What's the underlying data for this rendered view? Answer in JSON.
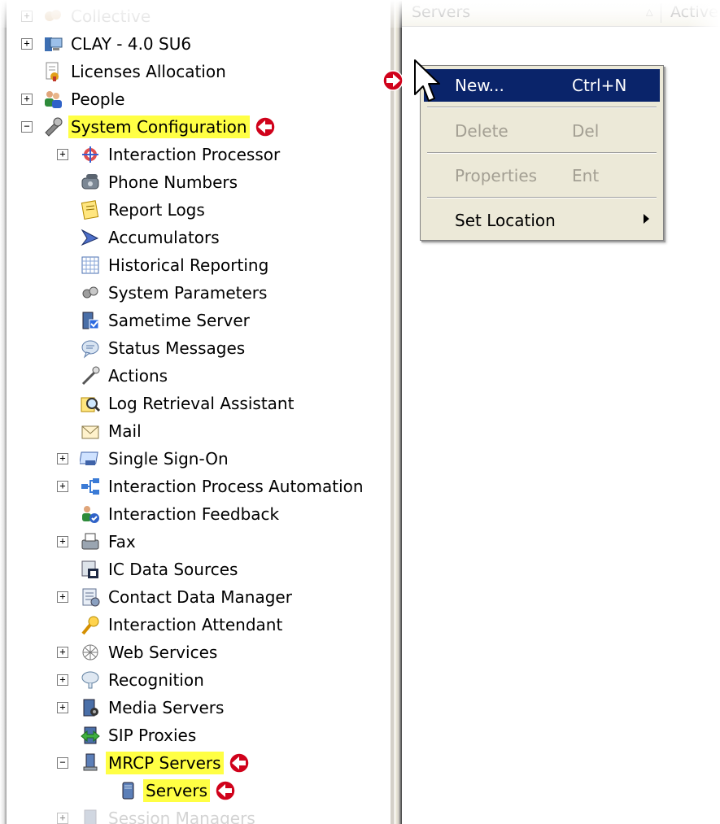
{
  "list_header": {
    "columns": [
      "Servers",
      "Active"
    ]
  },
  "tree": [
    {
      "id": "collective",
      "label": "Collective",
      "expander": "+",
      "icon": "collective-icon",
      "dim": true
    },
    {
      "id": "clay",
      "label": "CLAY - 4.0 SU6",
      "expander": "+",
      "icon": "server-computer-icon"
    },
    {
      "id": "licenses",
      "label": "Licenses Allocation",
      "expander": null,
      "icon": "license-icon"
    },
    {
      "id": "people",
      "label": "People",
      "expander": "+",
      "icon": "people-icon"
    },
    {
      "id": "sysconfig",
      "label": "System Configuration",
      "expander": "−",
      "icon": "wrench-icon",
      "highlight": true,
      "arrow": true
    },
    {
      "id": "ip",
      "label": "Interaction Processor",
      "expander": "+",
      "icon": "processor-icon"
    },
    {
      "id": "phone",
      "label": "Phone Numbers",
      "expander": null,
      "icon": "phone-icon"
    },
    {
      "id": "reportlogs",
      "label": "Report Logs",
      "expander": null,
      "icon": "notepad-icon"
    },
    {
      "id": "accum",
      "label": "Accumulators",
      "expander": null,
      "icon": "accumulator-icon"
    },
    {
      "id": "histrep",
      "label": "Historical Reporting",
      "expander": null,
      "icon": "grid-icon"
    },
    {
      "id": "sysparams",
      "label": "System Parameters",
      "expander": null,
      "icon": "gears-icon"
    },
    {
      "id": "sametime",
      "label": "Sametime Server",
      "expander": null,
      "icon": "sametime-server-icon"
    },
    {
      "id": "status",
      "label": "Status Messages",
      "expander": null,
      "icon": "speech-bubble-icon"
    },
    {
      "id": "actions",
      "label": "Actions",
      "expander": null,
      "icon": "wand-icon"
    },
    {
      "id": "logret",
      "label": "Log Retrieval Assistant",
      "expander": null,
      "icon": "magnifier-icon"
    },
    {
      "id": "mail",
      "label": "Mail",
      "expander": null,
      "icon": "envelope-icon"
    },
    {
      "id": "sso",
      "label": "Single Sign-On",
      "expander": "+",
      "icon": "sso-icon"
    },
    {
      "id": "ipa",
      "label": "Interaction Process Automation",
      "expander": "+",
      "icon": "flowchart-icon"
    },
    {
      "id": "feedback",
      "label": "Interaction Feedback",
      "expander": null,
      "icon": "feedback-icon"
    },
    {
      "id": "fax",
      "label": "Fax",
      "expander": "+",
      "icon": "fax-icon"
    },
    {
      "id": "icdata",
      "label": "IC Data Sources",
      "expander": null,
      "icon": "data-source-icon"
    },
    {
      "id": "cdm",
      "label": "Contact Data Manager",
      "expander": "+",
      "icon": "contact-data-icon"
    },
    {
      "id": "attendant",
      "label": "Interaction Attendant",
      "expander": null,
      "icon": "attendant-icon"
    },
    {
      "id": "websvc",
      "label": "Web Services",
      "expander": "+",
      "icon": "web-icon"
    },
    {
      "id": "recog",
      "label": "Recognition",
      "expander": "+",
      "icon": "recognition-icon"
    },
    {
      "id": "media",
      "label": "Media Servers",
      "expander": "+",
      "icon": "media-server-icon"
    },
    {
      "id": "sip",
      "label": "SIP Proxies",
      "expander": null,
      "icon": "sip-proxy-icon"
    },
    {
      "id": "mrcp",
      "label": "MRCP Servers",
      "expander": "−",
      "icon": "mrcp-server-icon",
      "highlight": true,
      "arrow": true
    },
    {
      "id": "servers",
      "label": "Servers",
      "expander": null,
      "icon": "server-icon",
      "highlight": true,
      "arrow": true
    },
    {
      "id": "sessmgr",
      "label": "Session Managers",
      "expander": "+",
      "icon": "session-manager-icon",
      "dim": true
    }
  ],
  "context_menu": {
    "items": [
      {
        "label": "New...",
        "shortcut": "Ctrl+N",
        "state": "selected"
      },
      {
        "label": "Delete",
        "shortcut": "Del",
        "state": "disabled"
      },
      {
        "label": "Properties",
        "shortcut": "Ent",
        "state": "disabled"
      },
      {
        "label": "Set Location",
        "shortcut": "",
        "state": "submenu"
      }
    ]
  },
  "colors": {
    "highlight": "#ffff44",
    "menu_selected": "#0a246a",
    "callout_arrow": "#d0021b"
  }
}
